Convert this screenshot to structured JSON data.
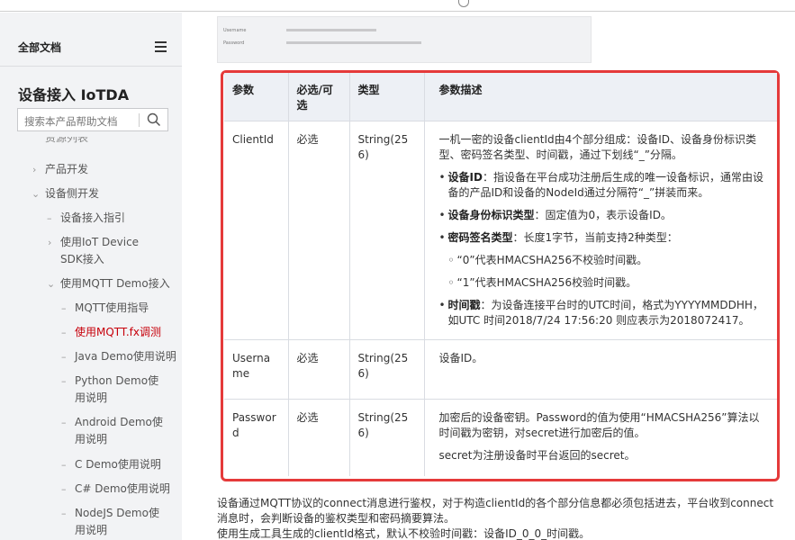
{
  "sidebar": {
    "header_title": "全部文档",
    "product_title": "设备接入 IoTDA",
    "search_placeholder": "搜索本产品帮助文档",
    "items": [
      {
        "label": "资源列表"
      },
      {
        "label": "产品开发"
      },
      {
        "label": "设备侧开发"
      },
      {
        "label": "设备接入指引"
      },
      {
        "label": "使用IoT Device SDK接入"
      },
      {
        "label": "使用MQTT Demo接入"
      },
      {
        "label": "MQTT使用指导"
      },
      {
        "label": "使用MQTT.fx调测"
      },
      {
        "label": "Java Demo使用说明"
      },
      {
        "label": "Python Demo使用说明"
      },
      {
        "label": "Android Demo使用说明"
      },
      {
        "label": "C Demo使用说明"
      },
      {
        "label": "C# Demo使用说明"
      },
      {
        "label": "NodeJS Demo使用说明"
      }
    ]
  },
  "screenshot_snippet": {
    "label_username": "Username",
    "label_password": "Password"
  },
  "table": {
    "headers": [
      "参数",
      "必选/可选",
      "类型",
      "参数描述"
    ],
    "rows": [
      {
        "param": "ClientId",
        "required": "必选",
        "type": "String(256)",
        "intro": "一机一密的设备clientId由4个部分组成：设备ID、设备身份标识类型、密码签名类型、时间戳，通过下划线“_”分隔。",
        "b1_title": "设备ID",
        "b1_text": "：指设备在平台成功注册后生成的唯一设备标识，通常由设备的产品ID和设备的NodeId通过分隔符“_”拼装而来。",
        "b2_title": "设备身份标识类型",
        "b2_text": "：固定值为0，表示设备ID。",
        "b3_title": "密码签名类型",
        "b3_text": "：长度1字节，当前支持2种类型：",
        "sub1": "“0”代表HMACSHA256不校验时间戳。",
        "sub2": "“1”代表HMACSHA256校验时间戳。",
        "b4_title": "时间戳",
        "b4_text": "：为设备连接平台时的UTC时间，格式为YYYYMMDDHH，如UTC 时间2018/7/24 17:56:20 则应表示为2018072417。"
      },
      {
        "param": "Username",
        "required": "必选",
        "type": "String(256)",
        "desc": "设备ID。"
      },
      {
        "param": "Password",
        "required": "必选",
        "type": "String(256)",
        "desc1": "加密后的设备密钥。Password的值为使用“HMACSHA256”算法以时间戳为密钥，对secret进行加密后的值。",
        "desc2": "secret为注册设备时平台返回的secret。"
      }
    ]
  },
  "after_text": {
    "p1": "设备通过MQTT协议的connect消息进行鉴权，对于构造clientId的各个部分信息都必须包括进去，平台收到connect消息时，会判断设备的鉴权类型和密码摘要算法。",
    "p2": "使用生成工具生成的clientId格式，默认不校验时间戳：设备ID_0_0_时间戳。"
  },
  "colors": {
    "accent_red": "#c7000b",
    "highlight_border": "#e53a3a",
    "table_header_bg": "#edf0f5",
    "sidebar_bg": "#f2f3f5"
  },
  "icons": [
    "menu-icon",
    "search-icon",
    "chevron-right-icon",
    "chevron-down-icon",
    "dash-icon"
  ]
}
